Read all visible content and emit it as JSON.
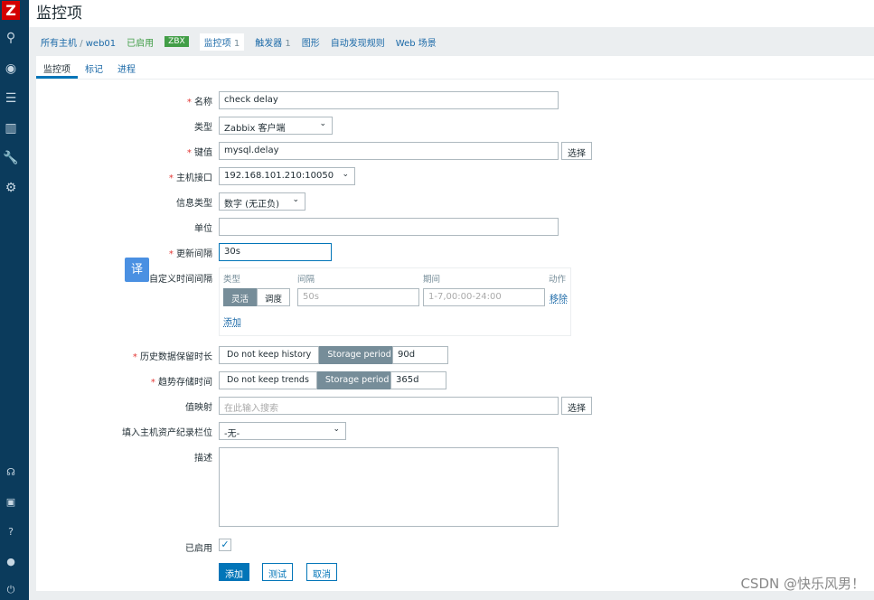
{
  "sidebar": {
    "logo": "Z",
    "icons": [
      "search-icon",
      "eye-icon",
      "list-icon",
      "chart-icon",
      "wrench-icon",
      "gear-icon"
    ],
    "bottom_icons": [
      "headset-icon",
      "zabbix-share-icon",
      "help-icon",
      "user-icon",
      "power-icon"
    ]
  },
  "header": {
    "title": "监控项"
  },
  "breadcrumb": {
    "all_hosts": "所有主机",
    "sep": "/",
    "host": "web01",
    "status": "已启用",
    "zbx": "ZBX",
    "items": "监控项",
    "items_count": "1",
    "triggers": "触发器",
    "triggers_count": "1",
    "graphs": "图形",
    "discovery": "自动发现规则",
    "web": "Web 场景"
  },
  "tabs": [
    "监控项",
    "标记",
    "进程"
  ],
  "form": {
    "name": {
      "label": "名称",
      "value": "check delay"
    },
    "type": {
      "label": "类型",
      "value": "Zabbix 客户端"
    },
    "key": {
      "label": "键值",
      "value": "mysql.delay",
      "button": "选择"
    },
    "interface": {
      "label": "主机接口",
      "value": "192.168.101.210:10050"
    },
    "info_type": {
      "label": "信息类型",
      "value": "数字 (无正负)"
    },
    "units": {
      "label": "单位",
      "value": ""
    },
    "update_interval": {
      "label": "更新间隔",
      "value": "30s"
    },
    "custom_intervals": {
      "label": "自定义时间间隔",
      "col_type": "类型",
      "col_interval": "间隔",
      "col_period": "期间",
      "col_action": "动作",
      "flexible": "灵活",
      "scheduling": "调度",
      "interval_placeholder": "50s",
      "period_placeholder": "1-7,00:00-24:00",
      "remove": "移除",
      "add": "添加"
    },
    "history": {
      "label": "历史数据保留时长",
      "opt1": "Do not keep history",
      "opt2": "Storage period",
      "value": "90d"
    },
    "trends": {
      "label": "趋势存储时间",
      "opt1": "Do not keep trends",
      "opt2": "Storage period",
      "value": "365d"
    },
    "valuemap": {
      "label": "值映射",
      "placeholder": "在此输入搜索",
      "button": "选择"
    },
    "inventory": {
      "label": "填入主机资产纪录栏位",
      "value": "-无-"
    },
    "description": {
      "label": "描述",
      "value": ""
    },
    "enabled": {
      "label": "已启用",
      "checked": true
    },
    "buttons": {
      "add": "添加",
      "test": "测试",
      "cancel": "取消"
    }
  },
  "translate_badge": "译",
  "watermark": "CSDN @快乐风男！"
}
